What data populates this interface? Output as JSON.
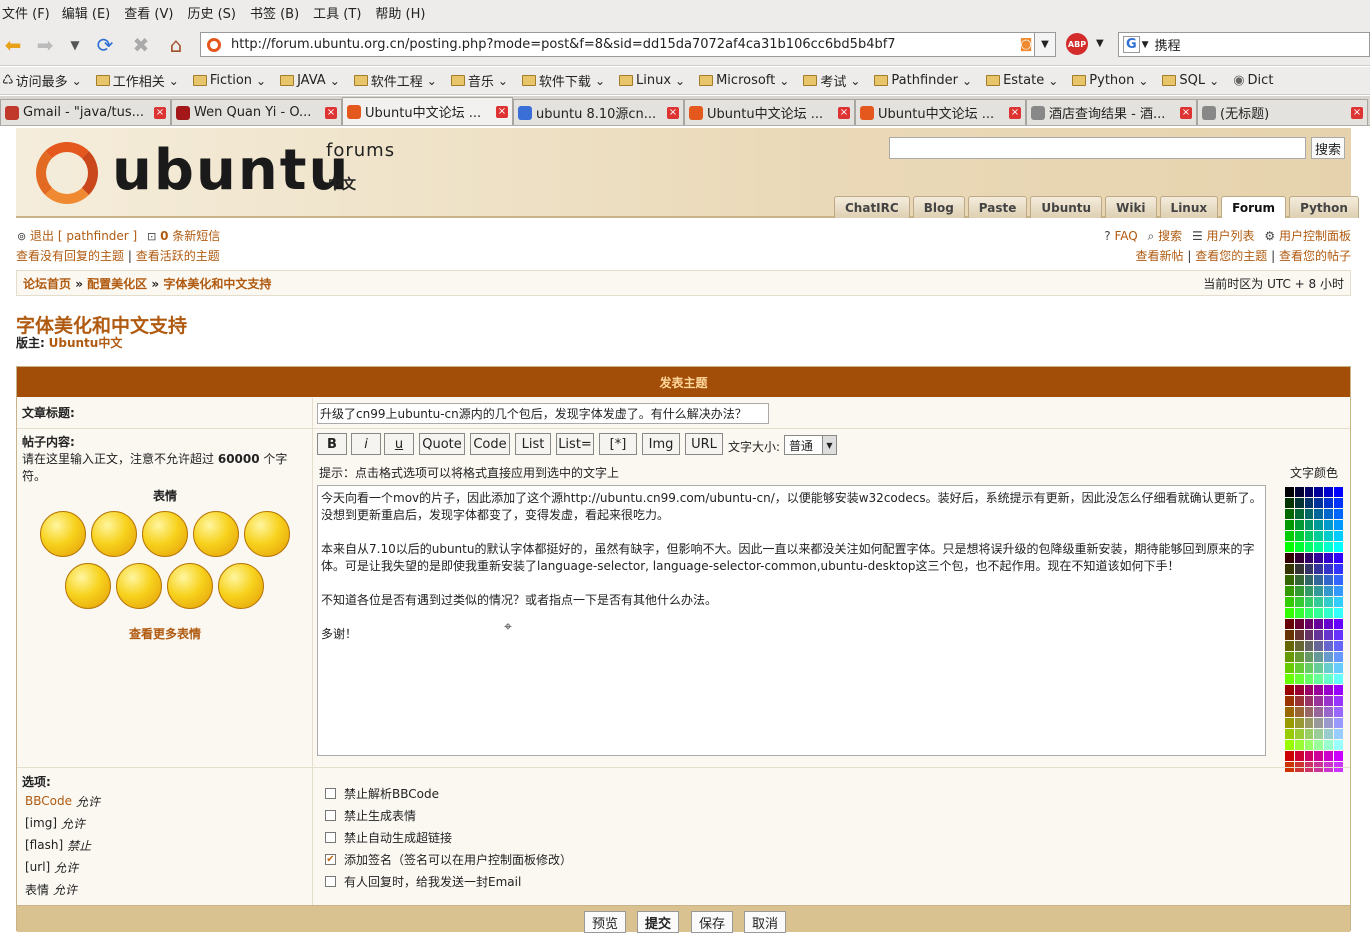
{
  "menu": [
    "文件 (F)",
    "编辑 (E)",
    "查看 (V)",
    "历史 (S)",
    "书签 (B)",
    "工具 (T)",
    "帮助 (H)"
  ],
  "url": "http://forum.ubuntu.org.cn/posting.php?mode=post&f=8&sid=dd15da7072af4ca31b106cc6bd5b4bf7",
  "search_engine_text": "携程",
  "bookmarks": [
    "访问最多",
    "工作相关",
    "Fiction",
    "JAVA",
    "软件工程",
    "音乐",
    "软件下载",
    "Linux",
    "Microsoft",
    "考试",
    "Pathfinder",
    "Estate",
    "Python",
    "SQL",
    "Dict"
  ],
  "tabs": [
    {
      "label": "Gmail - \"java/tus...",
      "color": "#c0392b"
    },
    {
      "label": "Wen Quan Yi - O...",
      "color": "#a31818"
    },
    {
      "label": "Ubuntu中文论坛 ...",
      "color": "#e4571d"
    },
    {
      "label": "ubuntu 8.10源cn...",
      "color": "#3a6fd8"
    },
    {
      "label": "Ubuntu中文论坛 ...",
      "color": "#e4571d"
    },
    {
      "label": "Ubuntu中文论坛 ...",
      "color": "#e4571d"
    },
    {
      "label": "酒店查询结果 - 酒...",
      "color": "#888888"
    },
    {
      "label": "(无标题)",
      "color": "#888888"
    }
  ],
  "header": {
    "brand": "ubuntu",
    "forums": "forums",
    "cn": "中文",
    "search_button": "搜索",
    "nav": [
      "ChatIRC",
      "Blog",
      "Paste",
      "Ubuntu",
      "Wiki",
      "Linux",
      "Forum",
      "Python"
    ]
  },
  "userbar": {
    "logout": "退出 [ pathfinder ]",
    "pm_count": "0",
    "pm_label": "条新短信",
    "faq": "FAQ",
    "search": "搜索",
    "memberlist": "用户列表",
    "ucp": "用户控制面板",
    "unanswered": "查看没有回复的主题",
    "active": "查看活跃的主题",
    "new_posts": "查看新帖",
    "your_topics": "查看您的主题",
    "your_posts": "查看您的帖子",
    "sep": "|"
  },
  "breadcrumb": {
    "home": "论坛首页",
    "sep": "»",
    "section": "配置美化区",
    "forum": "字体美化和中文支持",
    "timezone": "当前时区为 UTC + 8 小时"
  },
  "page": {
    "title": "字体美化和中文支持",
    "mod_label": "版主:",
    "mod_name": "Ubuntu中文"
  },
  "form": {
    "head": "发表主题",
    "subject_label": "文章标题:",
    "subject_value": "升级了cn99上ubuntu-cn源内的几个包后，发现字体发虚了。有什么解决办法？",
    "body_label": "帖子内容:",
    "body_hint_pre": "请在这里输入正文，注意不允许超过",
    "body_hint_num": "60000",
    "body_hint_post": "个字符。",
    "smilies_label": "表情",
    "more_smilies": "查看更多表情",
    "buttons": [
      "B",
      "i",
      "u",
      "Quote",
      "Code",
      "List",
      "List=",
      "[*]",
      "Img",
      "URL"
    ],
    "fontsize_label": "文字大小:",
    "fontsize_value": "普通",
    "tip": "提示：点击格式选项可以将格式直接应用到选中的文字上",
    "color_label": "文字颜色",
    "body_lines": [
      "今天向看一个mov的片子，因此添加了这个源http://ubuntu.cn99.com/ubuntu-cn/，以便能够安装w32codecs。装好后，系统提示有更新，因此没怎么仔细看就确认更新了。",
      "没想到更新重启后，发现字体都变了，变得发虚，看起来很吃力。",
      "",
      "本来自从7.10以后的ubuntu的默认字体都挺好的，虽然有缺字，但影响不大。因此一直以来都没关注如何配置字体。只是想将误升级的包降级重新安装，期待能够回到原来的字",
      "体。可是让我失望的是即使我重新安装了language-selector, language-selector-common,ubuntu-desktop这三个包，也不起作用。现在不知道该如何下手！",
      "",
      "不知道各位是否有遇到过类似的情况？或者指点一下是否有其他什么办法。",
      "",
      "多谢！"
    ],
    "options_label": "选项:",
    "option_status": [
      {
        "name": "BBCode",
        "state": "允许"
      },
      {
        "name": "[img]",
        "state": "允许"
      },
      {
        "name": "[flash]",
        "state": "禁止"
      },
      {
        "name": "[url]",
        "state": "允许"
      },
      {
        "name": "表情",
        "state": "允许"
      }
    ],
    "checkboxes": [
      {
        "label": "禁止解析BBCode",
        "checked": false
      },
      {
        "label": "禁止生成表情",
        "checked": false
      },
      {
        "label": "禁止自动生成超链接",
        "checked": false
      },
      {
        "label": "添加签名（签名可以在用户控制面板修改）",
        "checked": true
      },
      {
        "label": "有人回复时，给我发送一封Email",
        "checked": false
      }
    ],
    "submit_buttons": [
      "预览",
      "提交",
      "保存",
      "取消"
    ]
  },
  "colors": {
    "accent": "#b05a10",
    "header_bar": "#a24e08",
    "ubuntu_orange": "#e4571d"
  }
}
